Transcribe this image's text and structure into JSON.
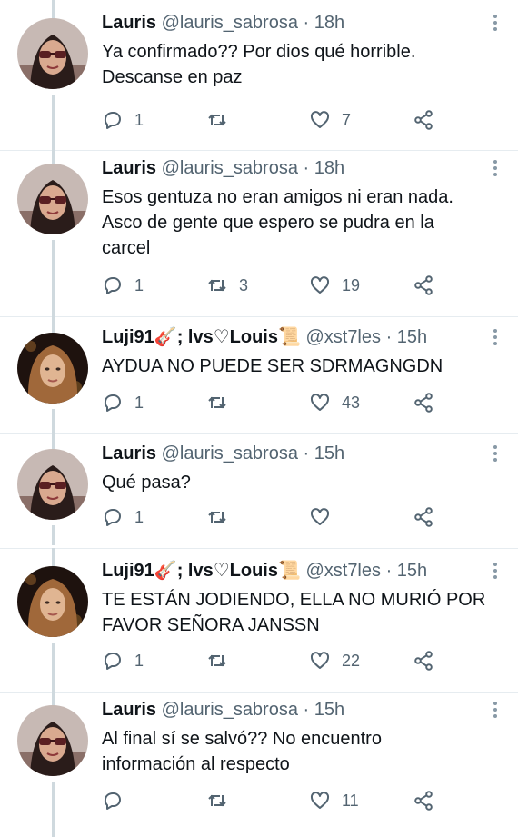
{
  "tweets": [
    {
      "name": "Lauris",
      "handle": "@lauris_sabrosa",
      "time": "18h",
      "text": [
        "Ya confirmado?? Por dios qué horrible.",
        "Descanse en paz"
      ],
      "replies": "1",
      "retweets": "",
      "likes": "7",
      "avatar": "lauris"
    },
    {
      "name": "Lauris",
      "handle": "@lauris_sabrosa",
      "time": "18h",
      "text": [
        "Esos gentuza no eran amigos ni eran nada.",
        "Asco de gente que espero se pudra en la",
        "carcel"
      ],
      "replies": "1",
      "retweets": "3",
      "likes": "19",
      "avatar": "lauris"
    },
    {
      "name": "Luji91🎸; lvs♡Louis📜",
      "handle": "@xst7les",
      "time": "15h",
      "text": [
        "AYDUA NO PUEDE SER SDRMAGNGDN"
      ],
      "replies": "1",
      "retweets": "",
      "likes": "43",
      "avatar": "luji"
    },
    {
      "name": "Lauris",
      "handle": "@lauris_sabrosa",
      "time": "15h",
      "text": [
        "Qué pasa?"
      ],
      "replies": "1",
      "retweets": "",
      "likes": "",
      "avatar": "lauris"
    },
    {
      "name": "Luji91🎸; lvs♡Louis📜",
      "handle": "@xst7les",
      "time": "15h",
      "text": [
        "TE ESTÁN JODIENDO, ELLA NO MURIÓ POR",
        "FAVOR SEÑORA JANSSN"
      ],
      "replies": "1",
      "retweets": "",
      "likes": "22",
      "avatar": "luji"
    },
    {
      "name": "Lauris",
      "handle": "@lauris_sabrosa",
      "time": "15h",
      "text": [
        "Al final sí se salvó?? No encuentro",
        "información al respecto"
      ],
      "replies": "",
      "retweets": "",
      "likes": "11",
      "avatar": "lauris"
    }
  ],
  "separator": " · ",
  "icons": {
    "reply": "reply-icon",
    "retweet": "retweet-icon",
    "like": "heart-icon",
    "share": "share-icon",
    "more": "more-icon"
  },
  "colors": {
    "text": "#0f1419",
    "secondary": "#536471",
    "thread_line": "#cfd9de",
    "divider": "#e6ecf0"
  }
}
